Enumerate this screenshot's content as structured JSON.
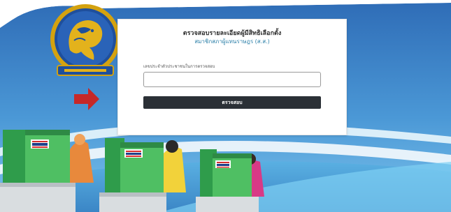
{
  "form": {
    "title": "ตรวจสอบรายละเอียดผู้มีสิทธิเลือกตั้ง",
    "subtitle": "สมาชิกสภาผู้แทนราษฎร (ส.ส.)",
    "id_label": "เลขประจำตัวประชาชนในการตรวจสอบ",
    "id_value": "",
    "id_placeholder": "",
    "submit_label": "ตรวจสอบ",
    "footer_line1": "",
    "footer_line2": ""
  },
  "colors": {
    "background_top": "#3a7cbf",
    "background_mid": "#5db2e3",
    "accent_arrow": "#c62828",
    "button": "#2b3036",
    "seal_gold": "#d4a20f",
    "seal_blue": "#1f4f9c"
  },
  "icons": {
    "seal": "interior-ministry-seal",
    "arrow": "arrow-right-icon"
  }
}
